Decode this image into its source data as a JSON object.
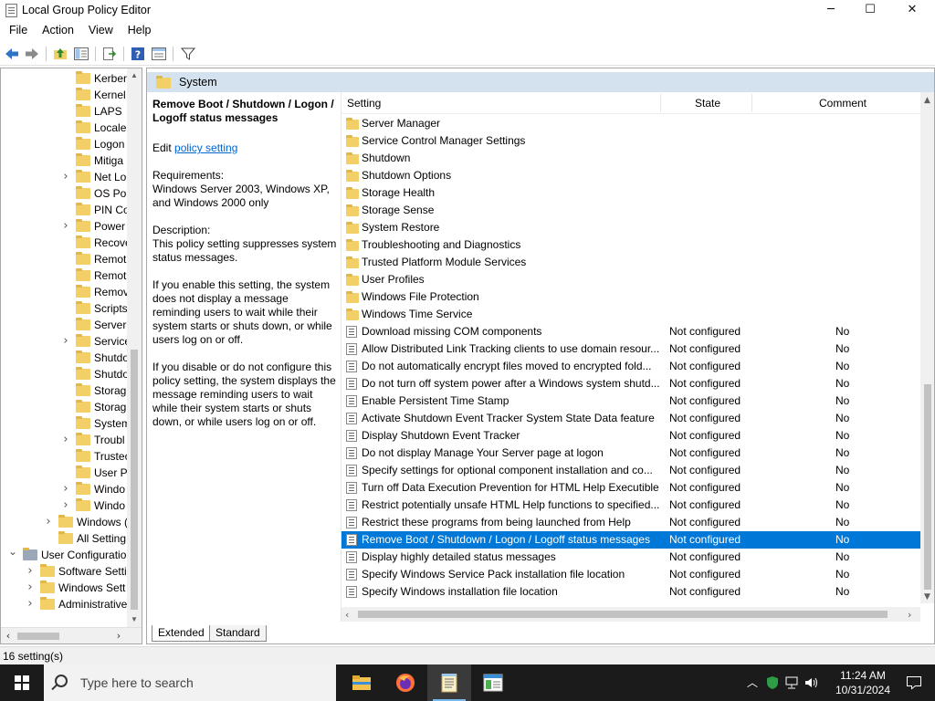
{
  "window": {
    "title": "Local Group Policy Editor",
    "minimize": "─",
    "maximize": "☐",
    "close": "✕"
  },
  "menu": [
    "File",
    "Action",
    "View",
    "Help"
  ],
  "tree": [
    {
      "label": "Kerber",
      "indent": 82,
      "chev": ""
    },
    {
      "label": "Kernel",
      "indent": 82,
      "chev": ""
    },
    {
      "label": "LAPS",
      "indent": 82,
      "chev": ""
    },
    {
      "label": "Locale",
      "indent": 82,
      "chev": ""
    },
    {
      "label": "Logon",
      "indent": 82,
      "chev": ""
    },
    {
      "label": "Mitiga",
      "indent": 82,
      "chev": ""
    },
    {
      "label": "Net Lo",
      "indent": 82,
      "chev": ">"
    },
    {
      "label": "OS Pol",
      "indent": 82,
      "chev": ""
    },
    {
      "label": "PIN Co",
      "indent": 82,
      "chev": ""
    },
    {
      "label": "Power",
      "indent": 82,
      "chev": ">"
    },
    {
      "label": "Recove",
      "indent": 82,
      "chev": ""
    },
    {
      "label": "Remot",
      "indent": 82,
      "chev": ""
    },
    {
      "label": "Remot",
      "indent": 82,
      "chev": ""
    },
    {
      "label": "Remov",
      "indent": 82,
      "chev": ""
    },
    {
      "label": "Scripts",
      "indent": 82,
      "chev": ""
    },
    {
      "label": "Server",
      "indent": 82,
      "chev": ""
    },
    {
      "label": "Service",
      "indent": 82,
      "chev": ">"
    },
    {
      "label": "Shutdo",
      "indent": 82,
      "chev": ""
    },
    {
      "label": "Shutdo",
      "indent": 82,
      "chev": ""
    },
    {
      "label": "Storag",
      "indent": 82,
      "chev": ""
    },
    {
      "label": "Storag",
      "indent": 82,
      "chev": ""
    },
    {
      "label": "System",
      "indent": 82,
      "chev": ""
    },
    {
      "label": "Troubl",
      "indent": 82,
      "chev": ">"
    },
    {
      "label": "Trustec",
      "indent": 82,
      "chev": ""
    },
    {
      "label": "User Pr",
      "indent": 82,
      "chev": ""
    },
    {
      "label": "Windo",
      "indent": 82,
      "chev": ">"
    },
    {
      "label": "Windo",
      "indent": 82,
      "chev": ">"
    },
    {
      "label": "Windows (",
      "indent": 63,
      "chev": ">"
    },
    {
      "label": "All Setting",
      "indent": 63,
      "chev": ""
    },
    {
      "label": "User Configuratio",
      "indent": 24,
      "chev": "v"
    },
    {
      "label": "Software Setti",
      "indent": 43,
      "chev": ">"
    },
    {
      "label": "Windows Sett",
      "indent": 43,
      "chev": ">"
    },
    {
      "label": "Administrative",
      "indent": 43,
      "chev": ">"
    }
  ],
  "pane": {
    "header": "System"
  },
  "description": {
    "title": "Remove Boot / Shutdown / Logon / Logoff status messages",
    "edit_prefix": "Edit ",
    "edit_link": "policy setting",
    "requirements_label": "Requirements:",
    "requirements": "Windows Server 2003, Windows XP, and Windows 2000 only",
    "description_label": "Description:",
    "p1": "This policy setting suppresses system status messages.",
    "p2": "If you enable this setting, the system does not display a message reminding users to wait while their system starts or shuts down, or while users log on or off.",
    "p3": "If you disable or do not configure this policy setting, the system displays the message reminding users to wait while their system starts or shuts down, or while users log on or off."
  },
  "columns": {
    "setting": "Setting",
    "state": "State",
    "comment": "Comment"
  },
  "rows": [
    {
      "type": "folder",
      "name": "Server Manager",
      "state": "",
      "comment": ""
    },
    {
      "type": "folder",
      "name": "Service Control Manager Settings",
      "state": "",
      "comment": ""
    },
    {
      "type": "folder",
      "name": "Shutdown",
      "state": "",
      "comment": ""
    },
    {
      "type": "folder",
      "name": "Shutdown Options",
      "state": "",
      "comment": ""
    },
    {
      "type": "folder",
      "name": "Storage Health",
      "state": "",
      "comment": ""
    },
    {
      "type": "folder",
      "name": "Storage Sense",
      "state": "",
      "comment": ""
    },
    {
      "type": "folder",
      "name": "System Restore",
      "state": "",
      "comment": ""
    },
    {
      "type": "folder",
      "name": "Troubleshooting and Diagnostics",
      "state": "",
      "comment": ""
    },
    {
      "type": "folder",
      "name": "Trusted Platform Module Services",
      "state": "",
      "comment": ""
    },
    {
      "type": "folder",
      "name": "User Profiles",
      "state": "",
      "comment": ""
    },
    {
      "type": "folder",
      "name": "Windows File Protection",
      "state": "",
      "comment": ""
    },
    {
      "type": "folder",
      "name": "Windows Time Service",
      "state": "",
      "comment": ""
    },
    {
      "type": "setting",
      "name": "Download missing COM components",
      "state": "Not configured",
      "comment": "No"
    },
    {
      "type": "setting",
      "name": "Allow Distributed Link Tracking clients to use domain resour...",
      "state": "Not configured",
      "comment": "No"
    },
    {
      "type": "setting",
      "name": "Do not automatically encrypt files moved to encrypted fold...",
      "state": "Not configured",
      "comment": "No"
    },
    {
      "type": "setting",
      "name": "Do not turn off system power after a Windows system shutd...",
      "state": "Not configured",
      "comment": "No"
    },
    {
      "type": "setting",
      "name": "Enable Persistent Time Stamp",
      "state": "Not configured",
      "comment": "No"
    },
    {
      "type": "setting",
      "name": "Activate Shutdown Event Tracker System State Data feature",
      "state": "Not configured",
      "comment": "No"
    },
    {
      "type": "setting",
      "name": "Display Shutdown Event Tracker",
      "state": "Not configured",
      "comment": "No"
    },
    {
      "type": "setting",
      "name": "Do not display Manage Your Server page at logon",
      "state": "Not configured",
      "comment": "No"
    },
    {
      "type": "setting",
      "name": "Specify settings for optional component installation and co...",
      "state": "Not configured",
      "comment": "No"
    },
    {
      "type": "setting",
      "name": "Turn off Data Execution Prevention for HTML Help Executible",
      "state": "Not configured",
      "comment": "No"
    },
    {
      "type": "setting",
      "name": "Restrict potentially unsafe HTML Help functions to specified...",
      "state": "Not configured",
      "comment": "No"
    },
    {
      "type": "setting",
      "name": "Restrict these programs from being launched from Help",
      "state": "Not configured",
      "comment": "No"
    },
    {
      "type": "setting",
      "name": "Remove Boot / Shutdown / Logon / Logoff status messages",
      "state": "Not configured",
      "comment": "No",
      "selected": true
    },
    {
      "type": "setting",
      "name": "Display highly detailed status messages",
      "state": "Not configured",
      "comment": "No"
    },
    {
      "type": "setting",
      "name": "Specify Windows Service Pack installation file location",
      "state": "Not configured",
      "comment": "No"
    },
    {
      "type": "setting",
      "name": "Specify Windows installation file location",
      "state": "Not configured",
      "comment": "No"
    }
  ],
  "tabs": {
    "extended": "Extended",
    "standard": "Standard"
  },
  "status": "16 setting(s)",
  "taskbar": {
    "search_placeholder": "Type here to search",
    "time": "11:24 AM",
    "date": "10/31/2024"
  },
  "colors": {
    "selection": "#0078d7",
    "header": "#d4e2ef",
    "folder": "#f3cf68",
    "link": "#0066cc"
  }
}
